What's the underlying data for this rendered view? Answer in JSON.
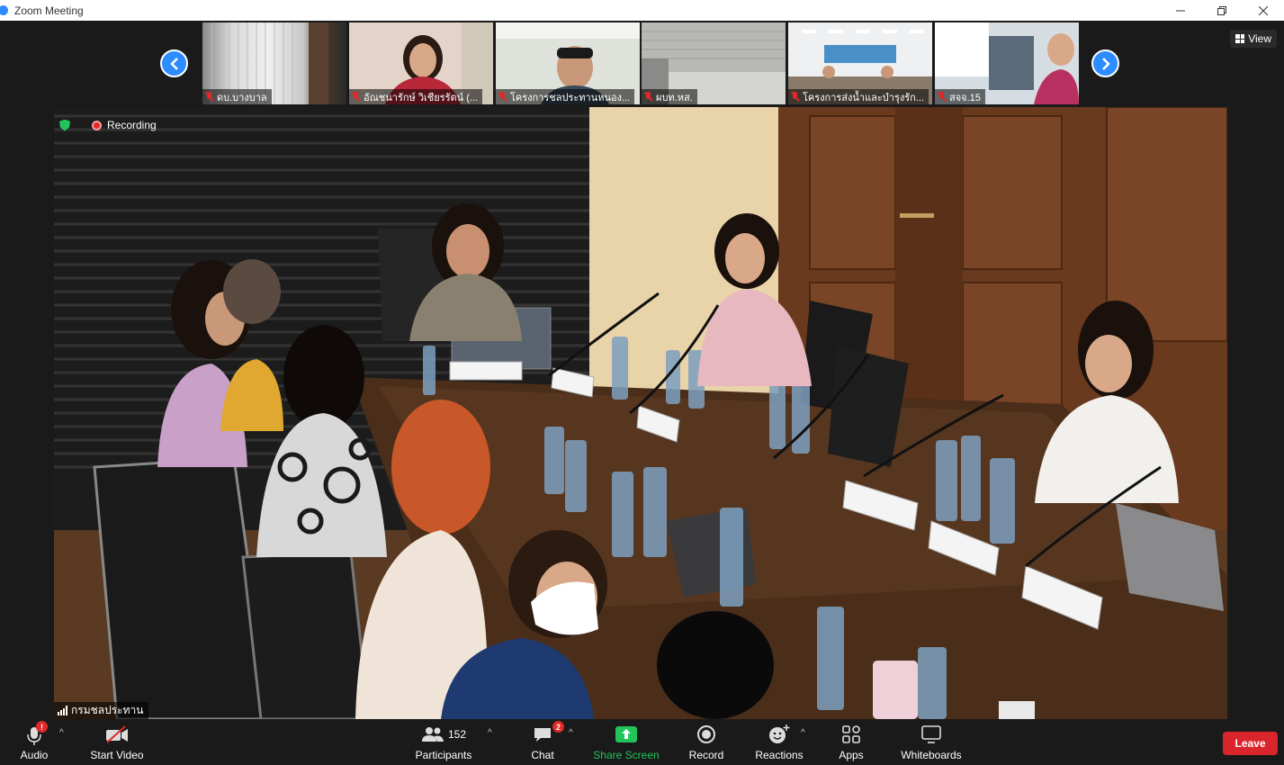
{
  "window": {
    "title": "Zoom Meeting",
    "controls": [
      "minimize",
      "restore",
      "close"
    ]
  },
  "thumbnails": [
    {
      "label": "ดบ.บางบาล",
      "muted": true
    },
    {
      "label": "อัณชนารักษ์ วิเชียรรัตน์ (...",
      "muted": true
    },
    {
      "label": "โครงการชลประทานหนอง...",
      "muted": true
    },
    {
      "label": "ผบท.หส.",
      "muted": true
    },
    {
      "label": "โครงการส่งน้ำและบำรุงรัก...",
      "muted": true
    },
    {
      "label": "สจจ.15",
      "muted": true
    }
  ],
  "view_button": {
    "label": "View"
  },
  "recording": {
    "label": "Recording"
  },
  "active_speaker": {
    "name": "กรมชลประทาน"
  },
  "toolbar": {
    "audio": {
      "label": "Audio",
      "alert": "!"
    },
    "video": {
      "label": "Start Video"
    },
    "participants": {
      "label": "Participants",
      "count": "152"
    },
    "chat": {
      "label": "Chat",
      "badge": "2"
    },
    "share": {
      "label": "Share Screen"
    },
    "record": {
      "label": "Record"
    },
    "reactions": {
      "label": "Reactions"
    },
    "apps": {
      "label": "Apps"
    },
    "whiteboards": {
      "label": "Whiteboards"
    },
    "leave": {
      "label": "Leave"
    }
  },
  "colors": {
    "accent": "#2d8cff",
    "share_green": "#21c45a",
    "leave_red": "#d9262c",
    "record_red": "#e02828"
  }
}
